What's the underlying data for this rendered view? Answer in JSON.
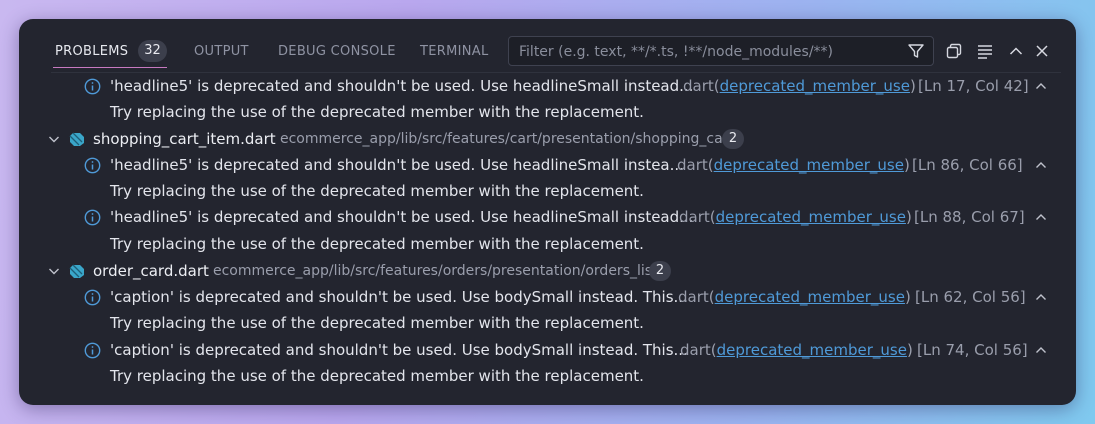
{
  "tabs": {
    "problems": "PROBLEMS",
    "problems_count": "32",
    "output": "OUTPUT",
    "debug_console": "DEBUG CONSOLE",
    "terminal": "TERMINAL"
  },
  "filter": {
    "placeholder": "Filter (e.g. text, **/*.ts, !**/node_modules/**)"
  },
  "hint_text": "Try replacing the use of the deprecated member with the replacement.",
  "top_problem": {
    "message": "'headline5' is deprecated and shouldn't be used. Use headlineSmall instead...",
    "source_prefix": "dart",
    "source_code": "deprecated_member_use",
    "location": "[Ln 17, Col 42]"
  },
  "files": [
    {
      "name": "shopping_cart_item.dart",
      "path": "ecommerce_app/lib/src/features/cart/presentation/shopping_cart",
      "count": "2",
      "problems": [
        {
          "message": "'headline5' is deprecated and shouldn't be used. Use headlineSmall instea...",
          "source_prefix": "dart",
          "source_code": "deprecated_member_use",
          "location": "[Ln 86, Col 66]"
        },
        {
          "message": "'headline5' is deprecated and shouldn't be used. Use headlineSmall instead...",
          "source_prefix": "dart",
          "source_code": "deprecated_member_use",
          "location": "[Ln 88, Col 67]"
        }
      ]
    },
    {
      "name": "order_card.dart",
      "path": "ecommerce_app/lib/src/features/orders/presentation/orders_list",
      "count": "2",
      "problems": [
        {
          "message": "'caption' is deprecated and shouldn't be used. Use bodySmall instead. This...",
          "source_prefix": "dart",
          "source_code": "deprecated_member_use",
          "location": "[Ln 62, Col 56]"
        },
        {
          "message": "'caption' is deprecated and shouldn't be used. Use bodySmall instead. This...",
          "source_prefix": "dart",
          "source_code": "deprecated_member_use",
          "location": "[Ln 74, Col 56]"
        }
      ]
    }
  ],
  "colors": {
    "panel_bg": "#23252f",
    "link": "#4f9ad8",
    "info": "#4f9ad8",
    "active_underline": "#c779c0"
  },
  "icons": {
    "filter": "funnel-icon",
    "copy": "copy-icon",
    "wrap": "word-wrap-icon",
    "maximize": "chevron-up-icon",
    "close": "close-icon",
    "info": "info-circle-icon",
    "file": "dart-file-icon",
    "expand": "chevron-down-icon"
  }
}
